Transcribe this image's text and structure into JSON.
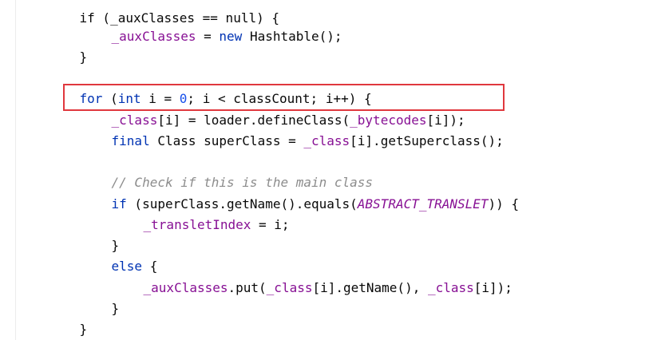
{
  "code": {
    "line0": {
      "text": "if (_auxClasses == null) {"
    },
    "line1": {
      "field": "_auxClasses",
      "eq": " = ",
      "kw": "new",
      "rest": " Hashtable();"
    },
    "line2": {
      "text": "}"
    },
    "line3": {
      "kw_for": "for",
      "p1": " (",
      "kw_int": "int",
      "p2": " i = ",
      "num": "0",
      "p3": "; i < classCount; i++) {"
    },
    "line4": {
      "field1": "_class",
      "p1": "[i] = loader.defineClass(",
      "field2": "_bytecodes",
      "p2": "[i]);"
    },
    "line5": {
      "kw": "final",
      "p1": " Class superClass = ",
      "field": "_class",
      "p2": "[i].getSuperclass();"
    },
    "line6": {
      "comment": "// Check if this is the main class"
    },
    "line7": {
      "kw": "if",
      "p1": " (superClass.getName().equals(",
      "const": "ABSTRACT_TRANSLET",
      "p2": ")) {"
    },
    "line8": {
      "field": "_transletIndex",
      "p1": " = i;"
    },
    "line9": {
      "text": "}"
    },
    "line10": {
      "kw": "else",
      "p1": " {"
    },
    "line11": {
      "field1": "_auxClasses",
      "p1": ".put(",
      "field2": "_class",
      "p2": "[i].getName(), ",
      "field3": "_class",
      "p3": "[i]);"
    },
    "line12": {
      "text": "}"
    },
    "line13": {
      "text": "}"
    }
  },
  "colors": {
    "keyword": "#0033b3",
    "field": "#871094",
    "number": "#1750eb",
    "comment": "#8c8c8c",
    "highlight": "#e0383e"
  }
}
